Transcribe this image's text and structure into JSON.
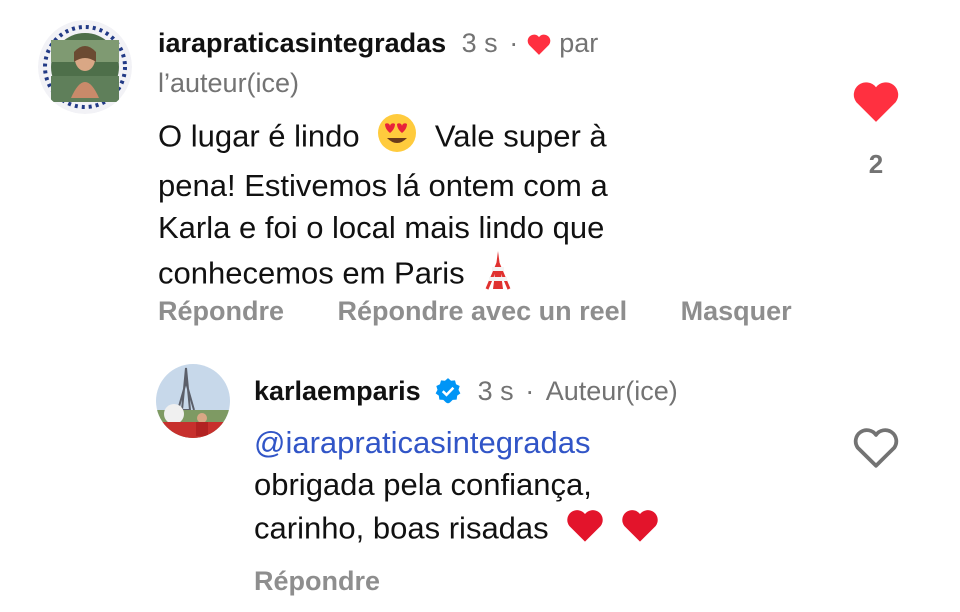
{
  "comment": {
    "username": "iarapraticasintegradas",
    "time": "3 s",
    "separator": "·",
    "liked_by_label_1": "par",
    "liked_by_label_2": "l’auteur(ice)",
    "text_1": "O lugar é lindo",
    "text_2": "Vale super à",
    "text_3": "pena! Estivemos lá ontem com a",
    "text_4": "Karla e foi  o local mais lindo que",
    "text_5": "conhecemos em Paris",
    "like_count": "2",
    "actions": {
      "reply": "Répondre",
      "reply_reel": "Répondre avec un reel",
      "hide": "Masquer"
    }
  },
  "reply": {
    "username": "karlaemparis",
    "time": "3 s",
    "separator": "·",
    "role": "Auteur(ice)",
    "mention": "@iarapraticasintegradas",
    "text_1": "obrigada pela confiança,",
    "text_2": "carinho, boas risadas",
    "actions": {
      "reply": "Répondre"
    }
  },
  "icons": {
    "liked_heart": "heart-filled-icon",
    "unliked_heart": "heart-outline-icon",
    "verified": "verified-badge-icon",
    "heart_eyes": "heart-eyes-emoji",
    "tower": "tokyo-tower-emoji",
    "red_heart": "red-heart-emoji"
  },
  "colors": {
    "like_red": "#ff3040",
    "mention_blue": "#3155c7",
    "meta_gray": "#737373",
    "action_gray": "#8e8e8e",
    "verified_blue": "#0095f6"
  }
}
